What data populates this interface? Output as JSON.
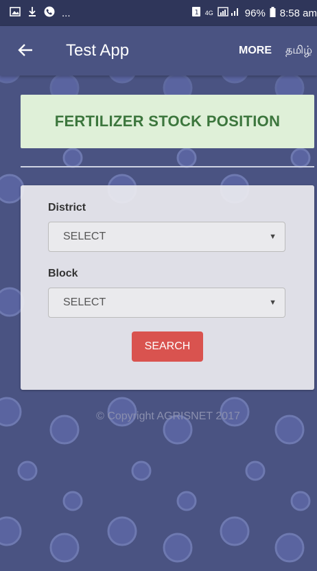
{
  "status_bar": {
    "battery": "96%",
    "time": "8:58 am",
    "network": "4G",
    "sim": "1",
    "ellipsis": "..."
  },
  "app_bar": {
    "title": "Test App",
    "more_label": "MORE",
    "language_label": "தமிழ்"
  },
  "banner": {
    "title": "FERTILIZER STOCK POSITION"
  },
  "form": {
    "district_label": "District",
    "district_value": "SELECT",
    "block_label": "Block",
    "block_value": "SELECT",
    "search_label": "SEARCH"
  },
  "footer": {
    "copyright": "© Copyright AGRISNET 2017"
  },
  "colors": {
    "background": "#4a5382",
    "status_bar": "#2f365a",
    "banner_bg": "#dff0d8",
    "banner_text": "#3c763d",
    "search_button": "#d9534f"
  }
}
